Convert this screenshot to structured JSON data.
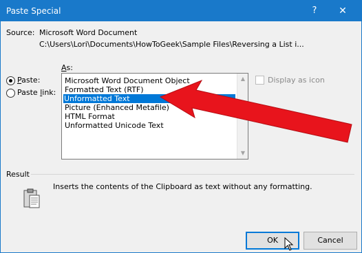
{
  "window": {
    "title": "Paste Special",
    "help_glyph": "?",
    "close_glyph": "✕"
  },
  "source": {
    "label": "Source:",
    "name": "Microsoft Word Document",
    "path": "C:\\Users\\Lori\\Documents\\HowToGeek\\Sample Files\\Reversing a List i..."
  },
  "options": {
    "paste_label_pre": "",
    "paste_label_key": "P",
    "paste_label_post": "aste:",
    "paste_link_label_pre": "Paste ",
    "paste_link_label_key": "l",
    "paste_link_label_post": "ink:",
    "paste_selected": true
  },
  "as_list": {
    "label_key": "A",
    "label_post": "s:",
    "items": [
      "Microsoft Word Document Object",
      "Formatted Text (RTF)",
      "Unformatted Text",
      "Picture (Enhanced Metafile)",
      "HTML Format",
      "Unformatted Unicode Text"
    ],
    "selected_index": 2
  },
  "display_as_icon": {
    "label": "Display as icon",
    "checked": false,
    "enabled": false
  },
  "result": {
    "label": "Result",
    "text": "Inserts the contents of the Clipboard as text without any formatting."
  },
  "buttons": {
    "ok": "OK",
    "cancel": "Cancel"
  },
  "colors": {
    "titlebar": "#1979ca",
    "selection": "#0078d7",
    "arrow": "#e8141c"
  }
}
